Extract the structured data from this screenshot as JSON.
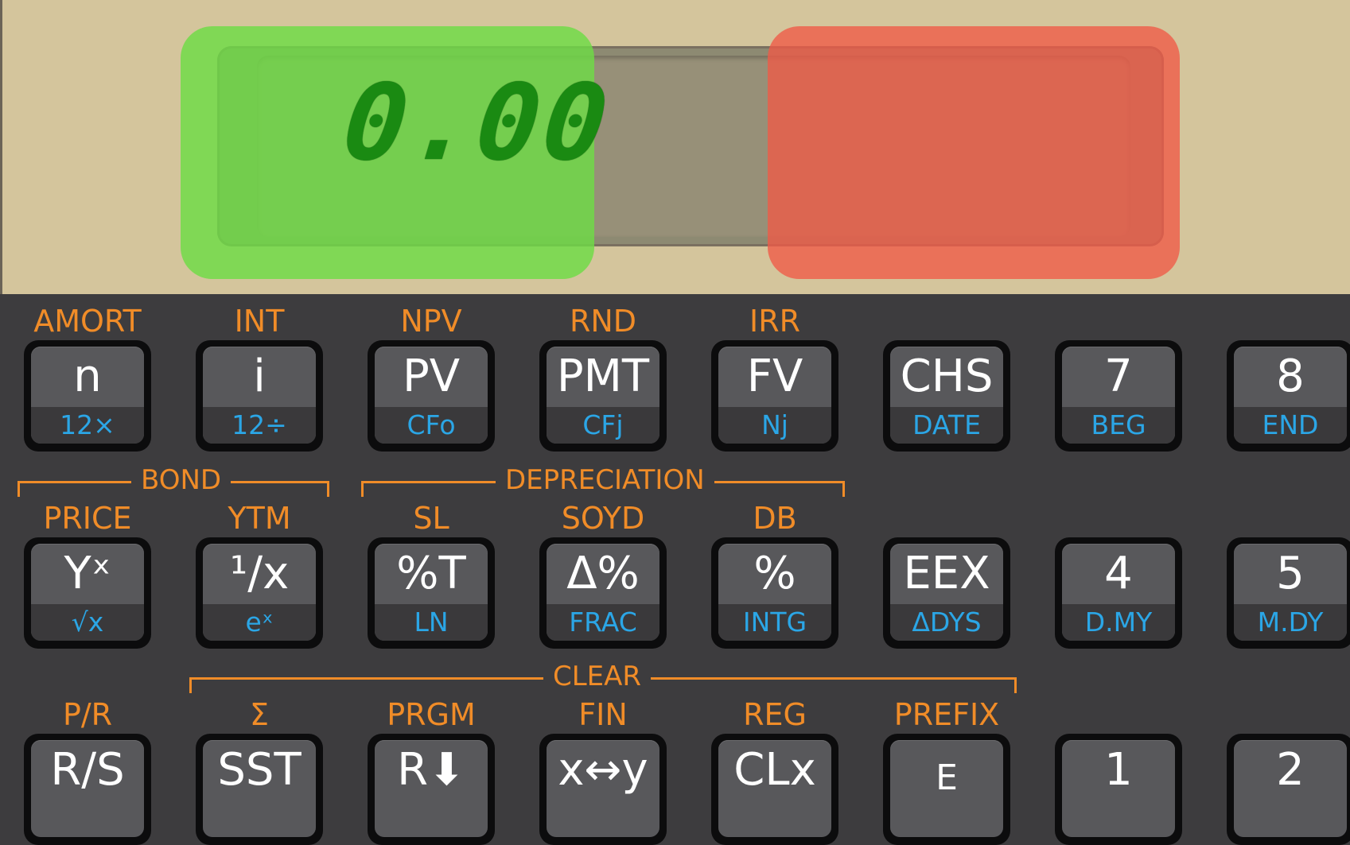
{
  "display": {
    "value": "0.00"
  },
  "colors": {
    "accent_orange": "#f08c28",
    "secondary_blue": "#2ba6e6",
    "lcd_digit": "#1a8a12",
    "overlay_green": "#6edc46",
    "overlay_red": "#f05a46"
  },
  "brackets": {
    "bond": "BOND",
    "depreciation": "DEPRECIATION",
    "clear": "CLEAR"
  },
  "row1": [
    {
      "above": "AMORT",
      "top": "n",
      "bottom": "12×"
    },
    {
      "above": "INT",
      "top": "i",
      "bottom": "12÷"
    },
    {
      "above": "NPV",
      "top": "PV",
      "bottom": "CFo"
    },
    {
      "above": "RND",
      "top": "PMT",
      "bottom": "CFj"
    },
    {
      "above": "IRR",
      "top": "FV",
      "bottom": "Nj"
    },
    {
      "above": "",
      "top": "CHS",
      "bottom": "DATE"
    },
    {
      "above": "",
      "top": "7",
      "bottom": "BEG"
    },
    {
      "above": "",
      "top": "8",
      "bottom": "END"
    }
  ],
  "row2": [
    {
      "above": "PRICE",
      "top": "Yˣ",
      "bottom": "√x"
    },
    {
      "above": "YTM",
      "top": "¹/x",
      "bottom": "eˣ"
    },
    {
      "above": "SL",
      "top": "%T",
      "bottom": "LN"
    },
    {
      "above": "SOYD",
      "top": "Δ%",
      "bottom": "FRAC"
    },
    {
      "above": "DB",
      "top": "%",
      "bottom": "INTG"
    },
    {
      "above": "",
      "top": "EEX",
      "bottom": "ΔDYS"
    },
    {
      "above": "",
      "top": "4",
      "bottom": "D.MY"
    },
    {
      "above": "",
      "top": "5",
      "bottom": "M.DY"
    }
  ],
  "row3": [
    {
      "above": "P/R",
      "top": "R/S"
    },
    {
      "above": "Σ",
      "top": "SST"
    },
    {
      "above": "PRGM",
      "top": "R⬇"
    },
    {
      "above": "FIN",
      "top": "x↔y"
    },
    {
      "above": "REG",
      "top": "CLx"
    },
    {
      "above": "PREFIX",
      "top": "E"
    },
    {
      "above": "",
      "top": "1"
    },
    {
      "above": "",
      "top": "2"
    }
  ]
}
